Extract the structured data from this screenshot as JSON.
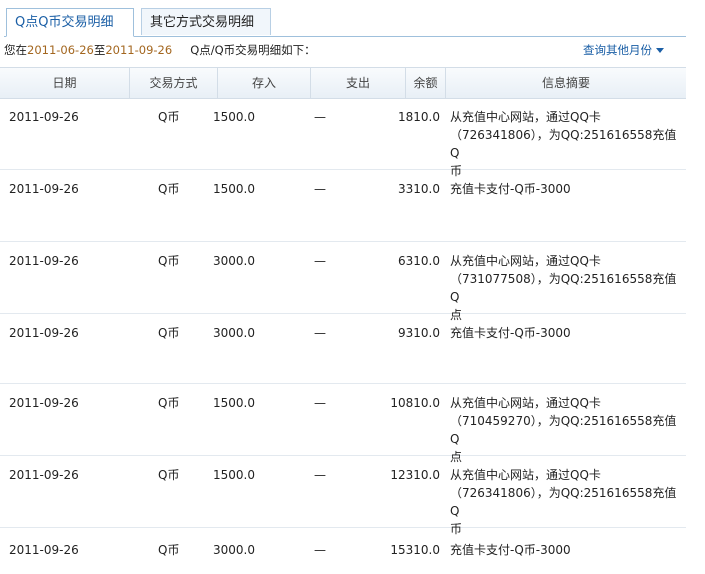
{
  "tabs": [
    {
      "label": "Q点Q币交易明细"
    },
    {
      "label": "其它方式交易明细"
    }
  ],
  "summary": {
    "prefix": "您在",
    "start_date": "2011-06-26",
    "to": "至",
    "end_date": "2011-09-26",
    "suffix": "Q点/Q币交易明细如下：",
    "query_link": "查询其他月份"
  },
  "columns": [
    "日期",
    "交易方式",
    "存入",
    "支出",
    "余额",
    "信息摘要"
  ],
  "rows": [
    {
      "date": "2011-09-26",
      "method": "Q币",
      "deposit": "1500.0",
      "expense": "—",
      "balance": "1810.0",
      "info": [
        "从充值中心网站，通过QQ卡",
        "（726341806），为QQ:251616558充值Q",
        "币"
      ]
    },
    {
      "date": "2011-09-26",
      "method": "Q币",
      "deposit": "1500.0",
      "expense": "—",
      "balance": "3310.0",
      "info": [
        "充值卡支付-Q币-3000"
      ]
    },
    {
      "date": "2011-09-26",
      "method": "Q币",
      "deposit": "3000.0",
      "expense": "—",
      "balance": "6310.0",
      "info": [
        "从充值中心网站，通过QQ卡",
        "（731077508），为QQ:251616558充值Q",
        "点"
      ]
    },
    {
      "date": "2011-09-26",
      "method": "Q币",
      "deposit": "3000.0",
      "expense": "—",
      "balance": "9310.0",
      "info": [
        "充值卡支付-Q币-3000"
      ]
    },
    {
      "date": "2011-09-26",
      "method": "Q币",
      "deposit": "1500.0",
      "expense": "—",
      "balance": "10810.0",
      "info": [
        "从充值中心网站，通过QQ卡",
        "（710459270），为QQ:251616558充值Q",
        "点"
      ]
    },
    {
      "date": "2011-09-26",
      "method": "Q币",
      "deposit": "1500.0",
      "expense": "—",
      "balance": "12310.0",
      "info": [
        "从充值中心网站，通过QQ卡",
        "（726341806），为QQ:251616558充值Q",
        "币"
      ]
    },
    {
      "date": "2011-09-26",
      "method": "Q币",
      "deposit": "3000.0",
      "expense": "—",
      "balance": "15310.0",
      "info": [
        "充值卡支付-Q币-3000"
      ]
    }
  ]
}
